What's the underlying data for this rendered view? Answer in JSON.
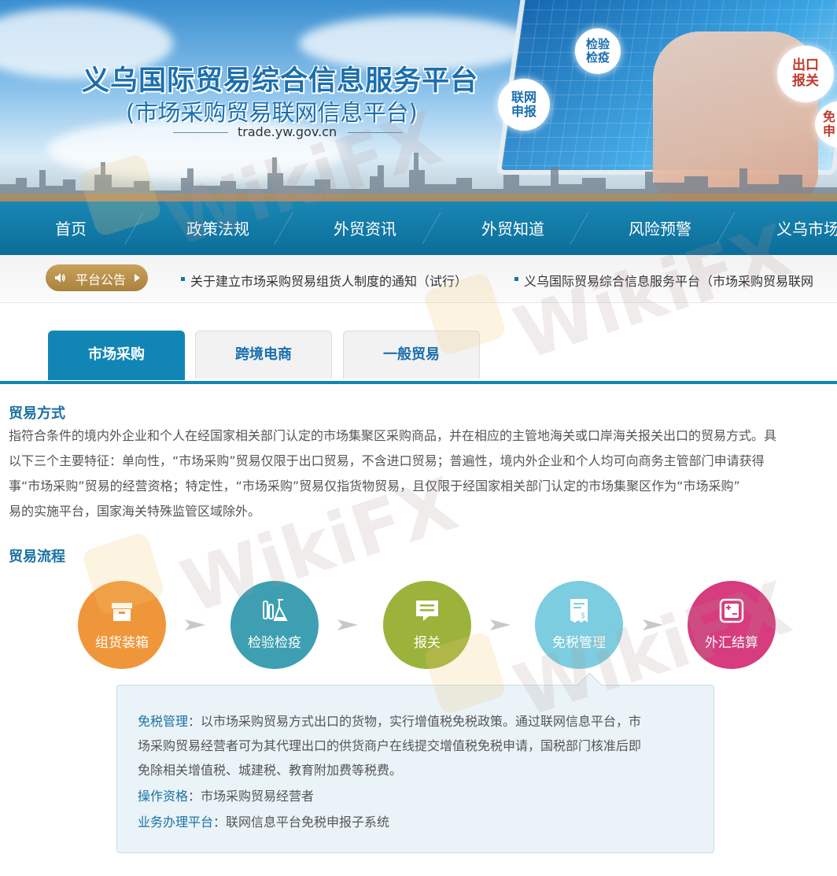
{
  "banner": {
    "title": "义乌国际贸易综合信息服务平台",
    "subtitle": "(市场采购贸易联网信息平台)",
    "url": "trade.yw.gov.cn",
    "bubbles": {
      "inspection": "检验\n检疫",
      "online_declare": "联网\n申报",
      "export_declare": "出口\n报关",
      "tax_free": "免\n申"
    }
  },
  "nav": {
    "items": [
      "首页",
      "政策法规",
      "外贸资讯",
      "外贸知道",
      "风险预警",
      "义乌市场"
    ]
  },
  "notice": {
    "badge_label": "平台公告",
    "items": [
      "关于建立市场采购贸易组货人制度的通知（试行）",
      "义乌国际贸易综合信息服务平台（市场采购贸易联网"
    ]
  },
  "tabs": [
    "市场采购",
    "跨境电商",
    "一般贸易"
  ],
  "trade_method": {
    "title": "贸易方式",
    "lines": [
      "指符合条件的境内外企业和个人在经国家相关部门认定的市场集聚区采购商品，并在相应的主管地海关或口岸海关报关出口的贸易方式。具",
      "以下三个主要特征：单向性，“市场采购”贸易仅限于出口贸易，不含进口贸易；普遍性，境内外企业和个人均可向商务主管部门申请获得",
      "事“市场采购”贸易的经营资格；特定性，“市场采购”贸易仅指货物贸易，且仅限于经国家相关部门认定的市场集聚区作为“市场采购”",
      "易的实施平台，国家海关特殊监管区域除外。"
    ]
  },
  "process": {
    "title": "贸易流程",
    "steps": [
      {
        "label": "组货装箱",
        "icon": "box-icon",
        "color": "#f0963a"
      },
      {
        "label": "检验检疫",
        "icon": "flask-icon",
        "color": "#3d9fb1"
      },
      {
        "label": "报关",
        "icon": "message-icon",
        "color": "#9bb33a"
      },
      {
        "label": "免税管理",
        "icon": "receipt-icon",
        "color": "#7dcde0"
      },
      {
        "label": "外汇结算",
        "icon": "calculator-icon",
        "color": "#d63c7e"
      }
    ]
  },
  "detail": {
    "desc_key": "免税管理",
    "desc_lines": [
      "：以市场采购贸易方式出口的货物，实行增值税免税政策。通过联网信息平台，市",
      "场采购贸易经营者可为其代理出口的供货商户在线提交增值税免税申请，国税部门核准后即",
      "免除相关增值税、城建税、教育附加费等税费。"
    ],
    "qualification_key": "操作资格",
    "qualification_val": "：市场采购贸易经营者",
    "platform_key": "业务办理平台",
    "platform_val": "：联网信息平台免税申报子系统"
  },
  "watermark": "WikiFX"
}
